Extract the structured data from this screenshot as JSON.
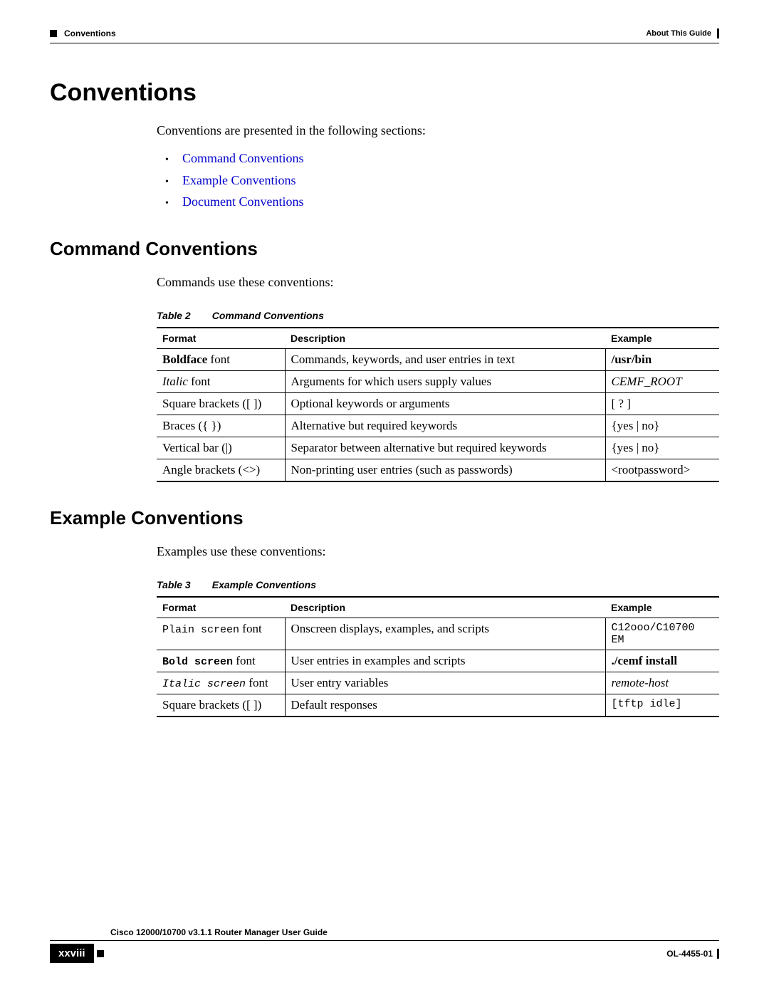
{
  "header": {
    "left": "Conventions",
    "right": "About This Guide"
  },
  "h1": "Conventions",
  "intro": "Conventions are presented in the following sections:",
  "links": {
    "command": "Command Conventions",
    "example": "Example Conventions",
    "document": "Document Conventions"
  },
  "section1": {
    "title": "Command Conventions",
    "lead": "Commands use these conventions:",
    "caption_num": "Table 2",
    "caption_txt": "Command Conventions",
    "headers": {
      "c1": "Format",
      "c2": "Description",
      "c3": "Example"
    },
    "rows": {
      "r1": {
        "f1": "Boldface",
        "f2": " font",
        "d": "Commands, keywords, and user entries in text",
        "e": "/usr/bin"
      },
      "r2": {
        "f1": "Italic",
        "f2": " font",
        "d": "Arguments for which users supply values",
        "e": "CEMF_ROOT"
      },
      "r3": {
        "f": "Square brackets ([ ])",
        "d": "Optional keywords or arguments",
        "e": "[ ? ]"
      },
      "r4": {
        "f": "Braces ({ })",
        "d": "Alternative but required keywords",
        "e": "{yes | no}"
      },
      "r5": {
        "f": "Vertical bar (|)",
        "d": "Separator between alternative but required keywords",
        "e": "{yes | no}"
      },
      "r6": {
        "f": "Angle brackets (<>)",
        "d": "Non-printing user entries (such as passwords)",
        "e": "<rootpassword>"
      }
    }
  },
  "section2": {
    "title": "Example Conventions",
    "lead": "Examples use these conventions:",
    "caption_num": "Table 3",
    "caption_txt": "Example Conventions",
    "headers": {
      "c1": "Format",
      "c2": "Description",
      "c3": "Example"
    },
    "rows": {
      "r1": {
        "f1": "Plain screen",
        "f2": " font",
        "d": "Onscreen displays, examples, and scripts",
        "e": "C12ooo/C10700 EM"
      },
      "r2": {
        "f1": "Bold screen",
        "f2": " font",
        "d": "User entries in examples and scripts",
        "e": "./cemf install"
      },
      "r3": {
        "f1": "Italic screen",
        "f2": " font",
        "d": "User entry variables",
        "e": "remote-host"
      },
      "r4": {
        "f": "Square brackets ([ ])",
        "d": "Default responses",
        "e": "[tftp idle]"
      }
    }
  },
  "footer": {
    "guide": "Cisco 12000/10700 v3.1.1 Router Manager User Guide",
    "page": "xxviii",
    "doc": "OL-4455-01"
  }
}
